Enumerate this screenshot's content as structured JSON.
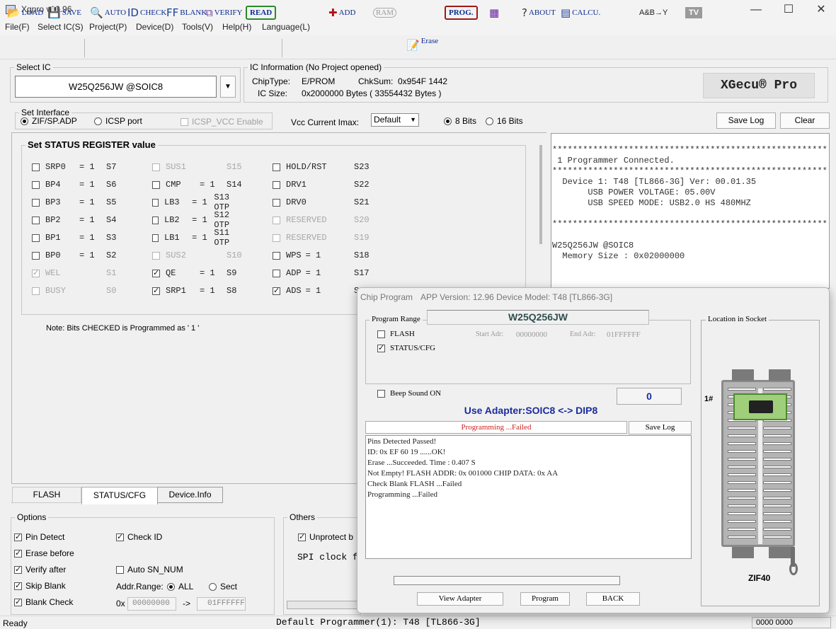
{
  "window": {
    "title": "Xgpro v12.96",
    "minimize": "—",
    "maximize": "☐",
    "close": "✕"
  },
  "menu": [
    "File(F)",
    "Select IC(S)",
    "Project(P)",
    "Device(D)",
    "Tools(V)",
    "Help(H)",
    "Language(L)"
  ],
  "toolbar": {
    "load": "LOAD",
    "save": "SAVE",
    "auto": "AUTO",
    "check": "CHECK",
    "blank": "BLANK",
    "verify": "VERIFY",
    "read": "READ",
    "add": "ADD",
    "ram": "RAM",
    "erase": "Erase",
    "prog": "PROG.",
    "about": "ABOUT",
    "calcu": "CALCU.",
    "tv": "TV",
    "gate_label": "A&B→Y"
  },
  "select_ic": {
    "label": "Select IC",
    "value": "W25Q256JW @SOIC8"
  },
  "ic_info": {
    "label": "IC Information (No Project opened)",
    "chip_type_label": "ChipType:",
    "chip_type": "E/PROM",
    "chksum_label": "ChkSum:",
    "chksum": "0x954F 1442",
    "ic_size_label": "IC Size:",
    "ic_size": "0x2000000 Bytes ( 33554432 Bytes )",
    "logo": "XGecu® Pro"
  },
  "interface": {
    "label": "Set Interface",
    "zif": "ZIF/SP.ADP",
    "icsp": "ICSP port",
    "icsp_vcc": "ICSP_VCC Enable",
    "vcc_label": "Vcc Current Imax:",
    "vcc_value": "Default",
    "bits8": "8 Bits",
    "bits16": "16 Bits",
    "save_log": "Save Log",
    "clear": "Clear"
  },
  "status_register": {
    "title": "Set STATUS REGISTER value",
    "note": "Note: Bits CHECKED is Programmed as ' 1 '",
    "col1": [
      {
        "name": "SRP0",
        "eq": "= 1",
        "bit": "S7",
        "checked": false,
        "disabled": false
      },
      {
        "name": "BP4",
        "eq": "= 1",
        "bit": "S6",
        "checked": false,
        "disabled": false
      },
      {
        "name": "BP3",
        "eq": "= 1",
        "bit": "S5",
        "checked": false,
        "disabled": false
      },
      {
        "name": "BP2",
        "eq": "= 1",
        "bit": "S4",
        "checked": false,
        "disabled": false
      },
      {
        "name": "BP1",
        "eq": "= 1",
        "bit": "S3",
        "checked": false,
        "disabled": false
      },
      {
        "name": "BP0",
        "eq": "= 1",
        "bit": "S2",
        "checked": false,
        "disabled": false
      },
      {
        "name": "WEL",
        "eq": "",
        "bit": "S1",
        "checked": true,
        "disabled": true
      },
      {
        "name": "BUSY",
        "eq": "",
        "bit": "S0",
        "checked": false,
        "disabled": true
      }
    ],
    "col2": [
      {
        "name": "SUS1",
        "eq": "",
        "bit": "S15",
        "checked": false,
        "disabled": true
      },
      {
        "name": "CMP",
        "eq": "= 1",
        "bit": "S14",
        "checked": false,
        "disabled": false
      },
      {
        "name": "LB3",
        "eq": "= 1",
        "bit": "S13 OTP",
        "checked": false,
        "disabled": false
      },
      {
        "name": "LB2",
        "eq": "= 1",
        "bit": "S12 OTP",
        "checked": false,
        "disabled": false
      },
      {
        "name": "LB1",
        "eq": "= 1",
        "bit": "S11 OTP",
        "checked": false,
        "disabled": false
      },
      {
        "name": "SUS2",
        "eq": "",
        "bit": "S10",
        "checked": false,
        "disabled": true
      },
      {
        "name": "QE",
        "eq": "= 1",
        "bit": "S9",
        "checked": true,
        "disabled": false
      },
      {
        "name": "SRP1",
        "eq": "= 1",
        "bit": "S8",
        "checked": true,
        "disabled": false
      }
    ],
    "col3": [
      {
        "name": "HOLD/RST",
        "eq": "",
        "bit": "S23",
        "checked": false,
        "disabled": false
      },
      {
        "name": "DRV1",
        "eq": "",
        "bit": "S22",
        "checked": false,
        "disabled": false
      },
      {
        "name": "DRV0",
        "eq": "",
        "bit": "S21",
        "checked": false,
        "disabled": false
      },
      {
        "name": "RESERVED",
        "eq": "",
        "bit": "S20",
        "checked": false,
        "disabled": true
      },
      {
        "name": "RESERVED",
        "eq": "",
        "bit": "S19",
        "checked": false,
        "disabled": true
      },
      {
        "name": "WPS",
        "eq": "= 1",
        "bit": "S18",
        "checked": false,
        "disabled": false
      },
      {
        "name": "ADP",
        "eq": "= 1",
        "bit": "S17",
        "checked": false,
        "disabled": false
      },
      {
        "name": "ADS",
        "eq": "= 1",
        "bit": "S16",
        "checked": true,
        "disabled": false
      }
    ]
  },
  "tabs": [
    "FLASH",
    "STATUS/CFG",
    "Device.Info"
  ],
  "options": {
    "label": "Options",
    "pin_detect": "Pin Detect",
    "check_id": "Check ID",
    "erase_before": "Erase before",
    "verify_after": "Verify after",
    "auto_sn": "Auto SN_NUM",
    "skip_blank": "Skip Blank",
    "addr_range": "Addr.Range:",
    "all": "ALL",
    "sect": "Sect",
    "blank_check": "Blank Check",
    "hex_prefix": "0x",
    "start": "00000000",
    "arrow": "->",
    "end": "01FFFFFF"
  },
  "others": {
    "label": "Others",
    "unprotect": "Unprotect b",
    "spi_clock": "SPI clock f"
  },
  "log": [
    "******************************************************",
    " 1 Programmer Connected.",
    "******************************************************",
    "  Device 1: T48 [TL866-3G] Ver: 00.01.35",
    "       USB POWER VOLTAGE: 05.00V",
    "       USB SPEED MODE: USB2.0 HS 480MHZ",
    "",
    "******************************************************",
    "",
    "W25Q256JW @SOIC8",
    "  Memory Size : 0x02000000"
  ],
  "popup": {
    "title": "Chip Program",
    "app_version": "APP Version: 12.96 Device Model: T48 [TL866-3G]",
    "chip": "W25Q256JW",
    "range_label": "Program Range",
    "flash": "FLASH",
    "status_cfg": "STATUS/CFG",
    "start_label": "Start Adr:",
    "start": "00000000",
    "end_label": "End Adr:",
    "end": "01FFFFFF",
    "beep": "Beep Sound ON",
    "counter": "0",
    "adapter": "Use Adapter:SOIC8 <-> DIP8",
    "status": "Programming  ...Failed",
    "save_log": "Save Log",
    "log": [
      "Pins Detected Passed!",
      "ID: 0x EF 60 19 ......OK!",
      "Erase  ...Succeeded. Time : 0.407 S",
      "Not Empty! FLASH ADDR: 0x 001000 CHIP DATA: 0x AA",
      "Check Blank FLASH ...Failed",
      "Programming  ...Failed"
    ],
    "location_label": "Location in Socket",
    "pin1": "1#",
    "socket": "ZIF40",
    "view_adapter": "View Adapter",
    "program": "Program",
    "back": "BACK"
  },
  "statusbar": {
    "left": "Ready",
    "center": "Default Programmer(1): T48 [TL866-3G]",
    "right": "0000 0000"
  }
}
